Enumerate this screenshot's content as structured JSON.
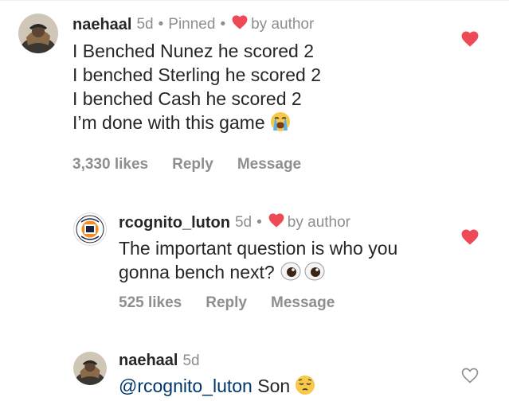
{
  "colors": {
    "like_red": "#ed4956",
    "text": "#262626",
    "muted": "#8e8e8e",
    "link": "#00376b"
  },
  "comments": [
    {
      "username": "naehaal",
      "time": "5d",
      "pinned": "Pinned",
      "liked_by": "by author",
      "lines": [
        "I Benched Nunez he scored 2",
        "I benched Sterling he scored 2",
        "I benched Cash he scored 2",
        "I’m done with this game"
      ],
      "end_emoji": "loudly-crying-face",
      "likes": "3,330 likes",
      "reply": "Reply",
      "message": "Message",
      "liked": true
    },
    {
      "username": "rcognito_luton",
      "time": "5d",
      "liked_by": "by author",
      "lines": [
        "The important question is who you",
        "gonna bench next?"
      ],
      "end_emoji": "eyes",
      "likes": "525 likes",
      "reply": "Reply",
      "message": "Message",
      "liked": true
    },
    {
      "username": "naehaal",
      "time": "5d",
      "mention": "@rcognito_luton",
      "text": "Son",
      "end_emoji": "pensive-face",
      "liked": false
    }
  ]
}
